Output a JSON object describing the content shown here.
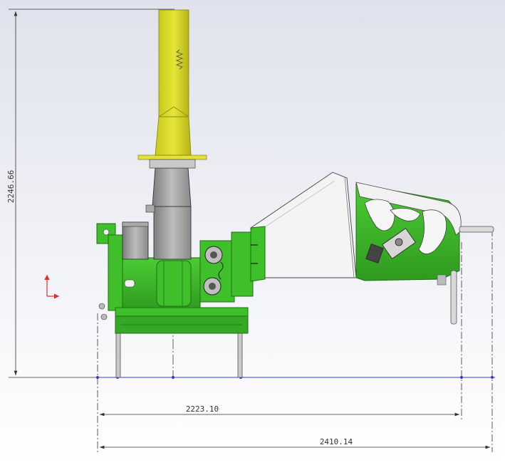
{
  "drawing": {
    "dimensions": {
      "height": "2246.66",
      "width_short": "2223.10",
      "width_long": "2410.14"
    },
    "colors": {
      "frame_green": "#3fbf2a",
      "frame_green_dark": "#2c8f1c",
      "chute_yellow": "#d4d42a",
      "chute_yellow_dark": "#a5a516",
      "steel_grey": "#9a9a9a",
      "hopper_white": "#f4f4f4",
      "dimension_line": "#333333",
      "baseline_blue": "#3a3adb",
      "axis_red": "#e0302a"
    }
  }
}
